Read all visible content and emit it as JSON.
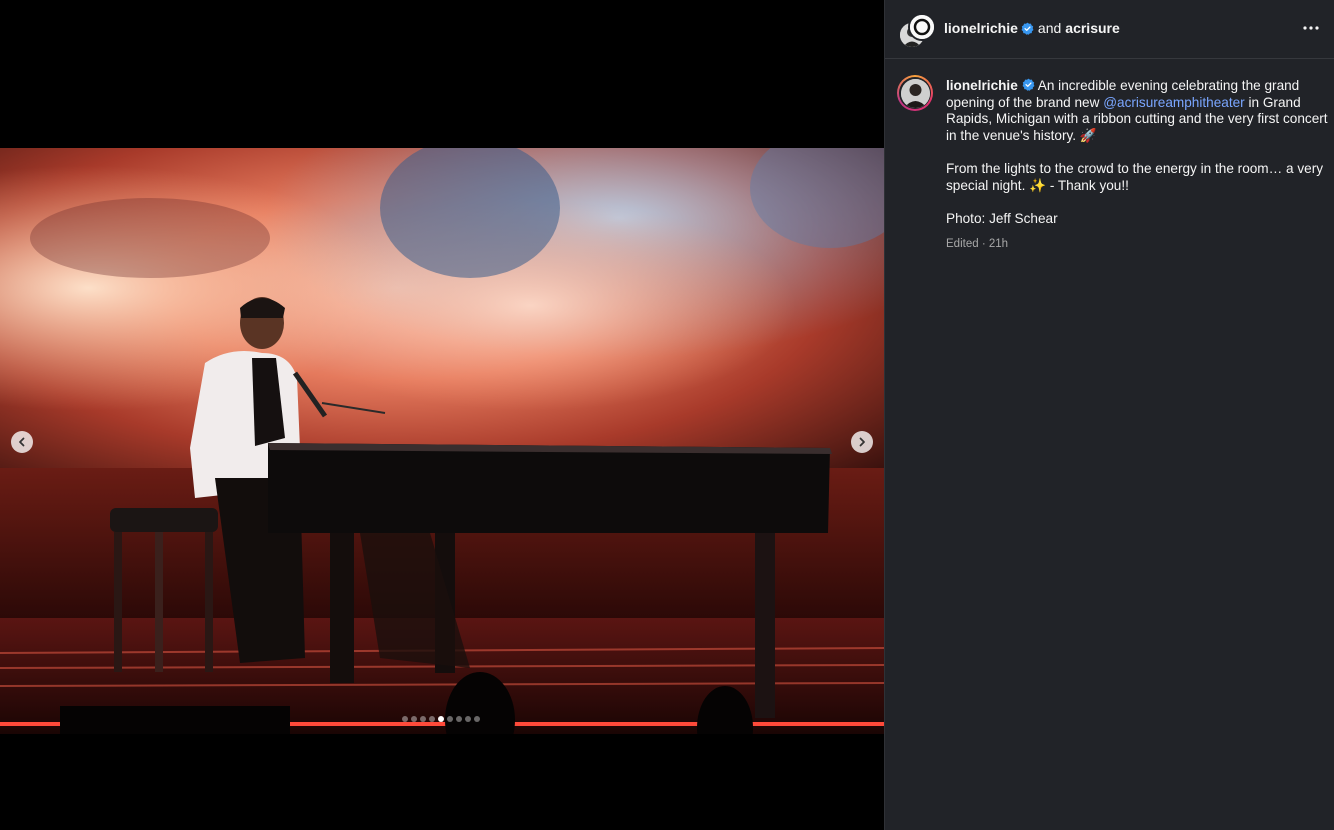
{
  "post": {
    "author": "lionelrichie",
    "collab_joiner": "and",
    "collaborator": "acrisure",
    "caption": {
      "username": "lionelrichie",
      "para1_before": "An incredible evening celebrating the grand opening of the brand new ",
      "mention": "@acrisureamphitheater",
      "para1_after": " in Grand Rapids, Michigan with a ribbon cutting and the very first concert in the venue's history. 🚀",
      "para2": "From the lights to the crowd to the energy in the room… a very special night. ✨ - Thank you!!",
      "para3": "Photo: Jeff Schear"
    },
    "edited_label": "Edited",
    "separator": "·",
    "time_ago": "21h"
  },
  "carousel": {
    "slide_count": 9,
    "active_index": 4
  },
  "icons": {
    "prev": "chevron-left-icon",
    "next": "chevron-right-icon",
    "more": "more-options-icon",
    "verified": "verified-badge-icon"
  },
  "colors": {
    "panel_bg": "#212328",
    "mention": "#7aa6ff",
    "verified": "#3897f0",
    "muted": "#a8a8a8"
  }
}
